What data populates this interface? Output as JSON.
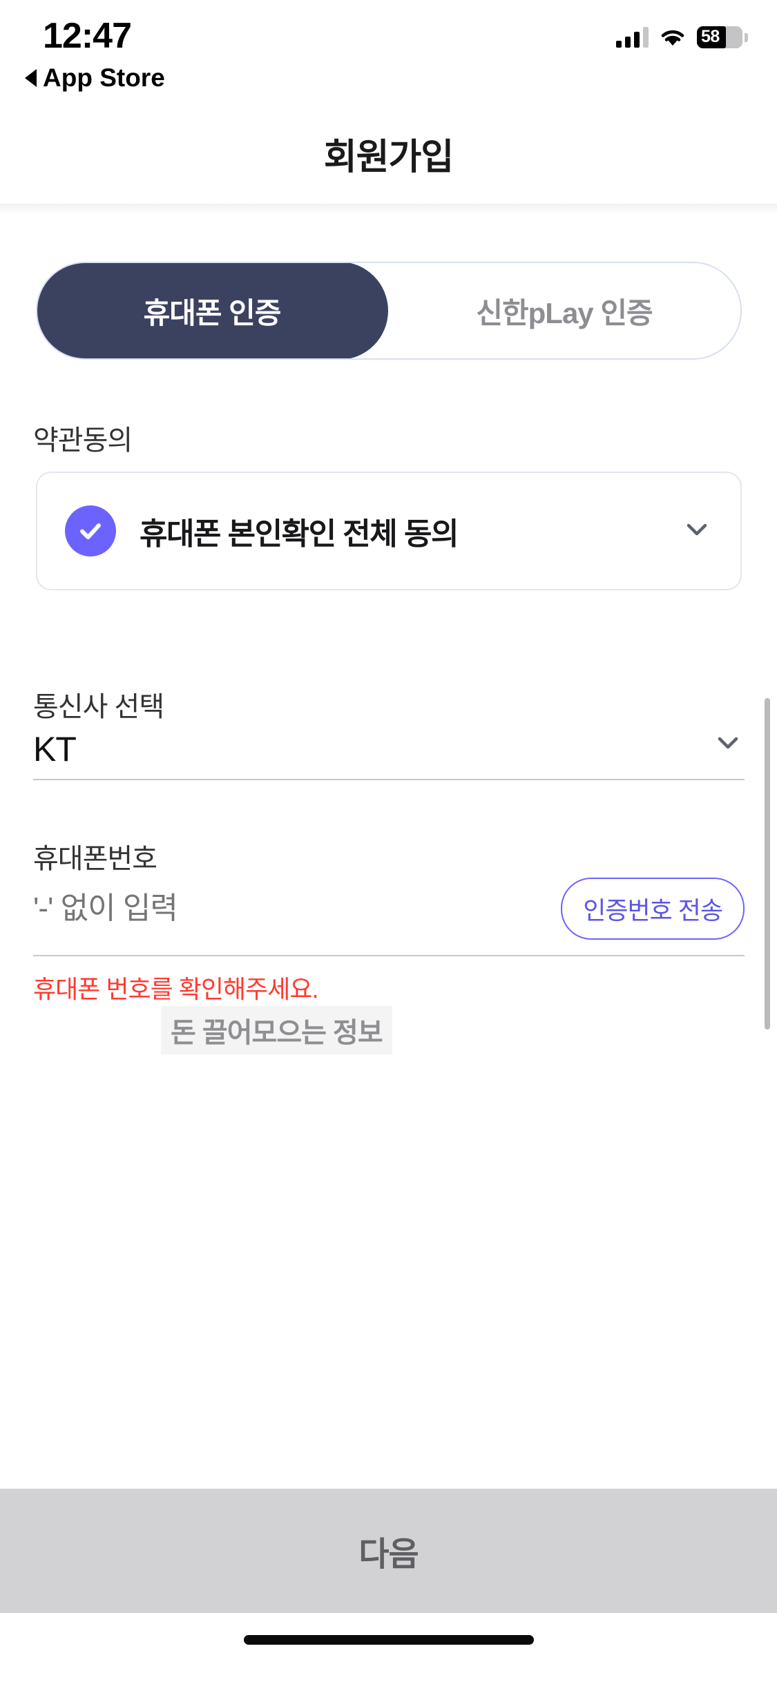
{
  "status_bar": {
    "time": "12:47",
    "back_label": "App Store",
    "back_icon": "triangle-left-icon",
    "signal_icon": "cellular-signal-icon",
    "wifi_icon": "wifi-icon",
    "battery_icon": "battery-icon",
    "battery_percent": "58"
  },
  "header": {
    "title": "회원가입"
  },
  "tabs": [
    {
      "label": "휴대폰 인증",
      "active": true
    },
    {
      "label": "신한pLay 인증",
      "active": false
    }
  ],
  "terms": {
    "section_label": "약관동의",
    "agree_all_label": "휴대폰 본인확인 전체 동의",
    "checkbox_icon": "check-circle-icon",
    "checkbox_checked": true,
    "expand_icon": "chevron-down-icon"
  },
  "carrier": {
    "section_label": "통신사 선택",
    "selected": "KT",
    "dropdown_icon": "chevron-down-icon"
  },
  "watermark": {
    "text": "돈 끌어모으는 정보"
  },
  "phone": {
    "section_label": "휴대폰번호",
    "placeholder": "'-' 없이 입력",
    "value": "",
    "send_code_label": "인증번호 전송",
    "error_message": "휴대폰 번호를 확인해주세요."
  },
  "footer": {
    "next_label": "다음",
    "next_enabled": false
  },
  "colors": {
    "tab_active_bg": "#3a4260",
    "tab_inactive_text": "#8d8d93",
    "checkbox_purple": "#6c63ff",
    "send_button_border": "#6c63ff",
    "error_red": "#ff3b30",
    "footer_disabled_bg": "#d2d2d4",
    "watermark_gray": "#8e8e93"
  }
}
